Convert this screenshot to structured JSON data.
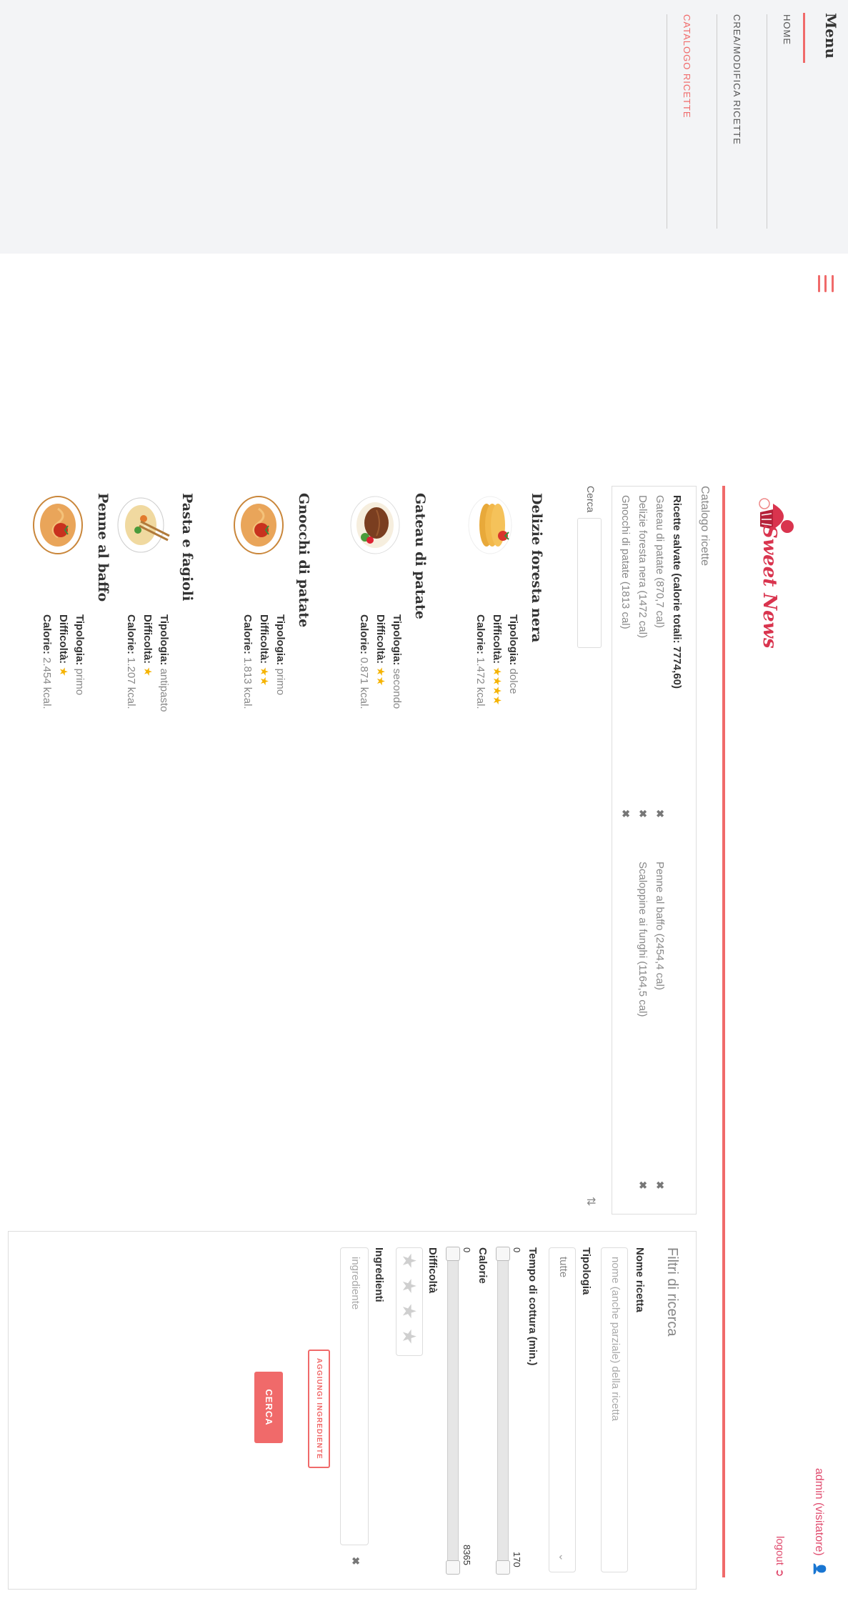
{
  "menu": {
    "title": "Menu",
    "items": [
      {
        "label": "HOME",
        "active": false
      },
      {
        "label": "CREA/MODIFICA RICETTE",
        "active": false
      },
      {
        "label": "CATALOGO RICETTE",
        "active": true
      }
    ]
  },
  "header": {
    "logo_text": "Sweet News",
    "user": "admin (visitatore)",
    "logout": "logout"
  },
  "breadcrumb": "Catalogo ricette",
  "saved": {
    "title": "Ricette salvate (calorie totali: 7774,60)",
    "items": [
      "Gateau di patate (870,7 cal)",
      "Delizie foresta nera (1472 cal)",
      "Gnocchi di patate (1813 cal)",
      "Penne al baffo (2454,4 cal)",
      "Scaloppine ai funghi (1164,5 cal)"
    ]
  },
  "search": {
    "label": "Cerca"
  },
  "recipes": [
    {
      "name": "Delizie foresta nera",
      "tipologia_label": "Tipologia:",
      "tipologia": "dolce",
      "difficolta_label": "Difficoltà:",
      "stars": "★★★★",
      "difficulty": 4,
      "calorie_label": "Calorie:",
      "calorie": "1.472 kcal.",
      "icon": "pancake-icon"
    },
    {
      "name": "Gateau di patate",
      "tipologia_label": "Tipologia:",
      "tipologia": "secondo",
      "difficolta_label": "Difficoltà:",
      "stars": "★★",
      "difficulty": 2,
      "calorie_label": "Calorie:",
      "calorie": "0.871 kcal.",
      "icon": "steak-icon"
    },
    {
      "name": "Gnocchi di patate",
      "tipologia_label": "Tipologia:",
      "tipologia": "primo",
      "difficolta_label": "Difficoltà:",
      "stars": "★★",
      "difficulty": 2,
      "calorie_label": "Calorie:",
      "calorie": "1.813 kcal.",
      "icon": "pasta-icon"
    },
    {
      "name": "Pasta e fagioli",
      "tipologia_label": "Tipologia:",
      "tipologia": "antipasto",
      "difficolta_label": "Difficoltà:",
      "stars": "★",
      "difficulty": 1,
      "calorie_label": "Calorie:",
      "calorie": "1.207 kcal.",
      "icon": "soup-icon"
    },
    {
      "name": "Penne al baffo",
      "tipologia_label": "Tipologia:",
      "tipologia": "primo",
      "difficolta_label": "Difficoltà:",
      "stars": "★",
      "difficulty": 1,
      "calorie_label": "Calorie:",
      "calorie": "2.454 kcal.",
      "icon": "pasta-icon"
    }
  ],
  "filters": {
    "title": "Filtri di ricerca",
    "nome_label": "Nome ricetta",
    "nome_placeholder": "nome (anche parziale) della ricetta",
    "tipologia_label": "Tipologia",
    "tipologia_value": "tutte",
    "tempo_label": "Tempo di cottura (min.)",
    "tempo_min": "0",
    "tempo_max": "170",
    "calorie_label": "Calorie",
    "calorie_min": "0",
    "calorie_max": "8365",
    "difficolta_label": "Difficoltà",
    "ingredienti_label": "Ingredienti",
    "ingrediente_placeholder": "ingrediente",
    "add_button": "AGGIUNGI INGREDIENTE",
    "cerca_button": "CERCA"
  },
  "colors": {
    "accent": "#f06a6a",
    "brand": "#d9344e",
    "star": "#f5b301"
  }
}
